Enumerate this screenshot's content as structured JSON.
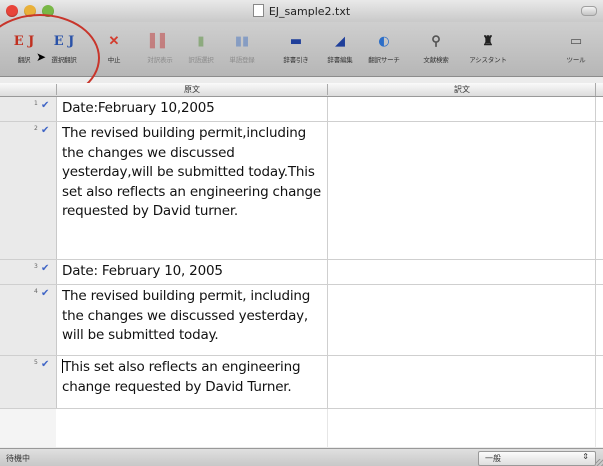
{
  "window": {
    "title": "EJ_sample2.txt"
  },
  "toolbar": {
    "tools": [
      {
        "label": "翻訳",
        "icon": "E J",
        "color": "#c03020"
      },
      {
        "label": "選択翻訳",
        "icon": "E J",
        "color": "#2a52a8"
      },
      {
        "label": "中止",
        "icon": "✕",
        "color": "#d33c2e"
      },
      {
        "label": "対訳表示",
        "icon": "▌▌",
        "color": "#c02a2a"
      },
      {
        "label": "訳語選択",
        "icon": "▮",
        "color": "#4a8a2a"
      },
      {
        "label": "単語登録",
        "icon": "▮▮",
        "color": "#3a6cc0"
      },
      {
        "label": "辞書引き",
        "icon": "▬",
        "color": "#1f3f9a"
      },
      {
        "label": "辞書編集",
        "icon": "◢",
        "color": "#1f3f9a"
      },
      {
        "label": "翻訳サーチ",
        "icon": "◐",
        "color": "#2c6ec8"
      },
      {
        "label": "文献検索",
        "icon": "⚲",
        "color": "#555555"
      },
      {
        "label": "アシスタント",
        "icon": "♜",
        "color": "#222222"
      },
      {
        "label": "ツール",
        "icon": "▭",
        "color": "#555555"
      }
    ]
  },
  "table": {
    "headers": {
      "source": "原文",
      "target": "訳文"
    },
    "rows": [
      {
        "num": "1",
        "text": "Date:February 10,2005"
      },
      {
        "num": "2",
        "text": "The revised building permit,including the changes we discussed yesterday,will be submitted today.This set also reflects an engineering change requested by David turner."
      },
      {
        "num": "3",
        "text": "Date: February 10, 2005"
      },
      {
        "num": "4",
        "text": "The revised building permit, including the changes we discussed yesterday, will be submitted today."
      },
      {
        "num": "5",
        "text": "This set also reflects an engineering change requested by David Turner."
      }
    ]
  },
  "status": {
    "text": "待機中",
    "mode": "一般"
  }
}
